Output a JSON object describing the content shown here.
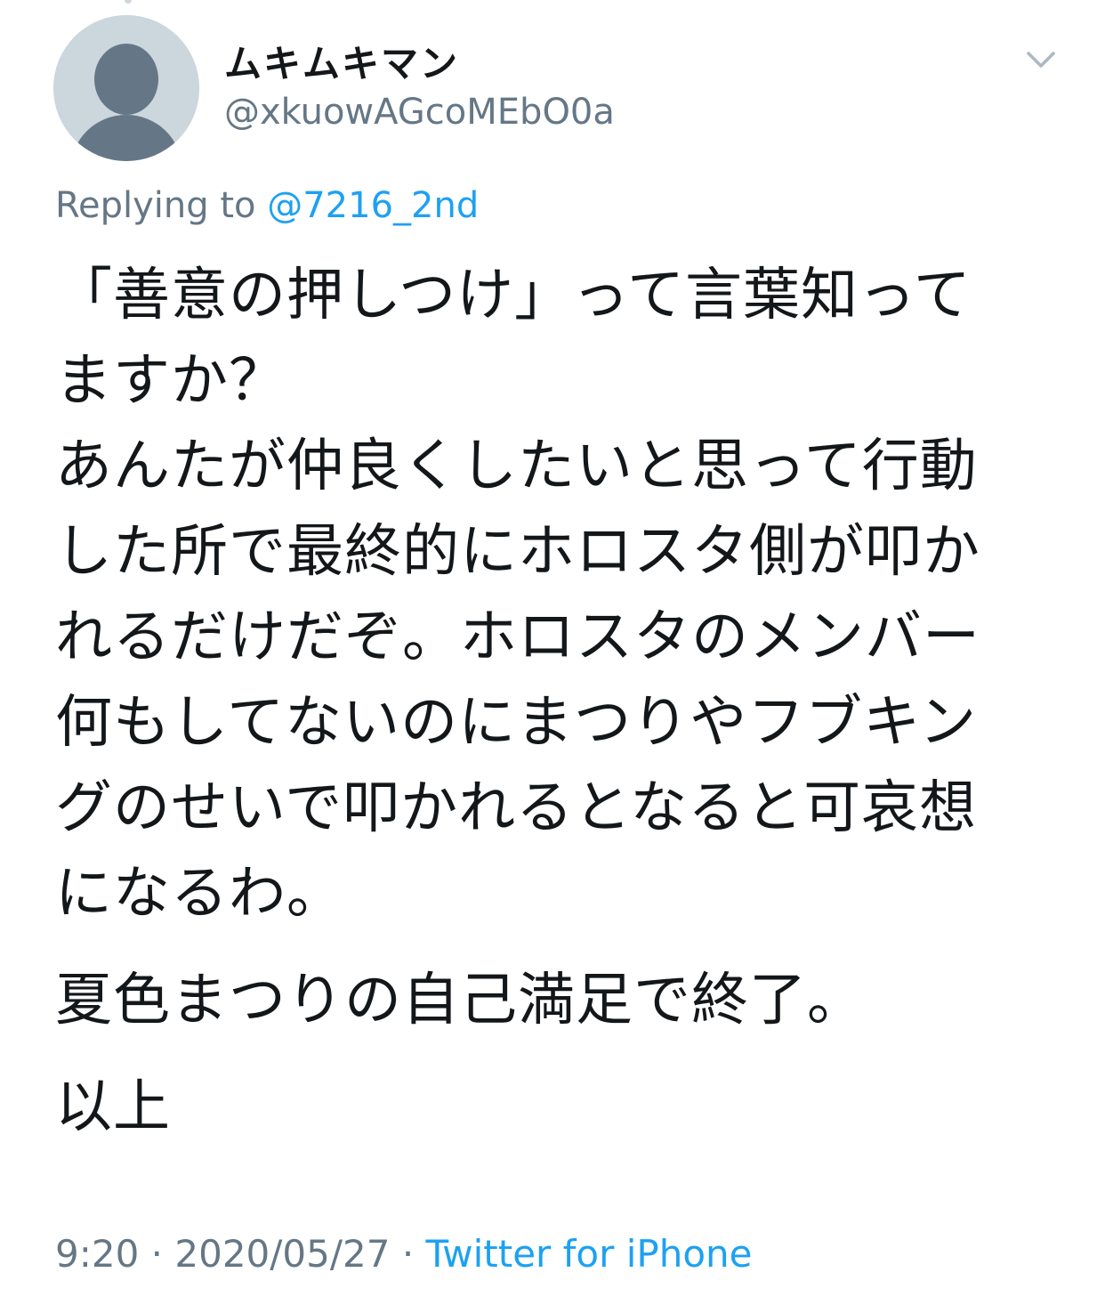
{
  "author": {
    "display_name": "ムキムキマン",
    "handle": "@xkuowAGcoMEbO0a"
  },
  "reply": {
    "prefix": "Replying to ",
    "mention": "@7216_2nd"
  },
  "tweet": {
    "lines": [
      "「善意の押しつけ」って言葉知って",
      "ますか？",
      "あんたが仲良くしたいと思って行動",
      "した所で最終的にホロスタ側が叩か",
      "れるだけだぞ。ホロスタのメンバー",
      "何もしてないのにまつりやフブキン",
      "グのせいで叩かれるとなると可哀想",
      "になるわ。"
    ],
    "paragraph2": "夏色まつりの自己満足で終了。",
    "paragraph3": "以上"
  },
  "meta": {
    "time": "9:20",
    "date": "2020/05/27",
    "separator": " · ",
    "source": "Twitter for iPhone"
  },
  "icons": {
    "avatar": "default-profile-icon",
    "more": "chevron-down-icon"
  },
  "colors": {
    "primary_text": "#14171a",
    "secondary_text": "#657786",
    "link": "#1da1f2",
    "avatar_bg": "#ccd6dd",
    "avatar_figure": "#657786"
  }
}
